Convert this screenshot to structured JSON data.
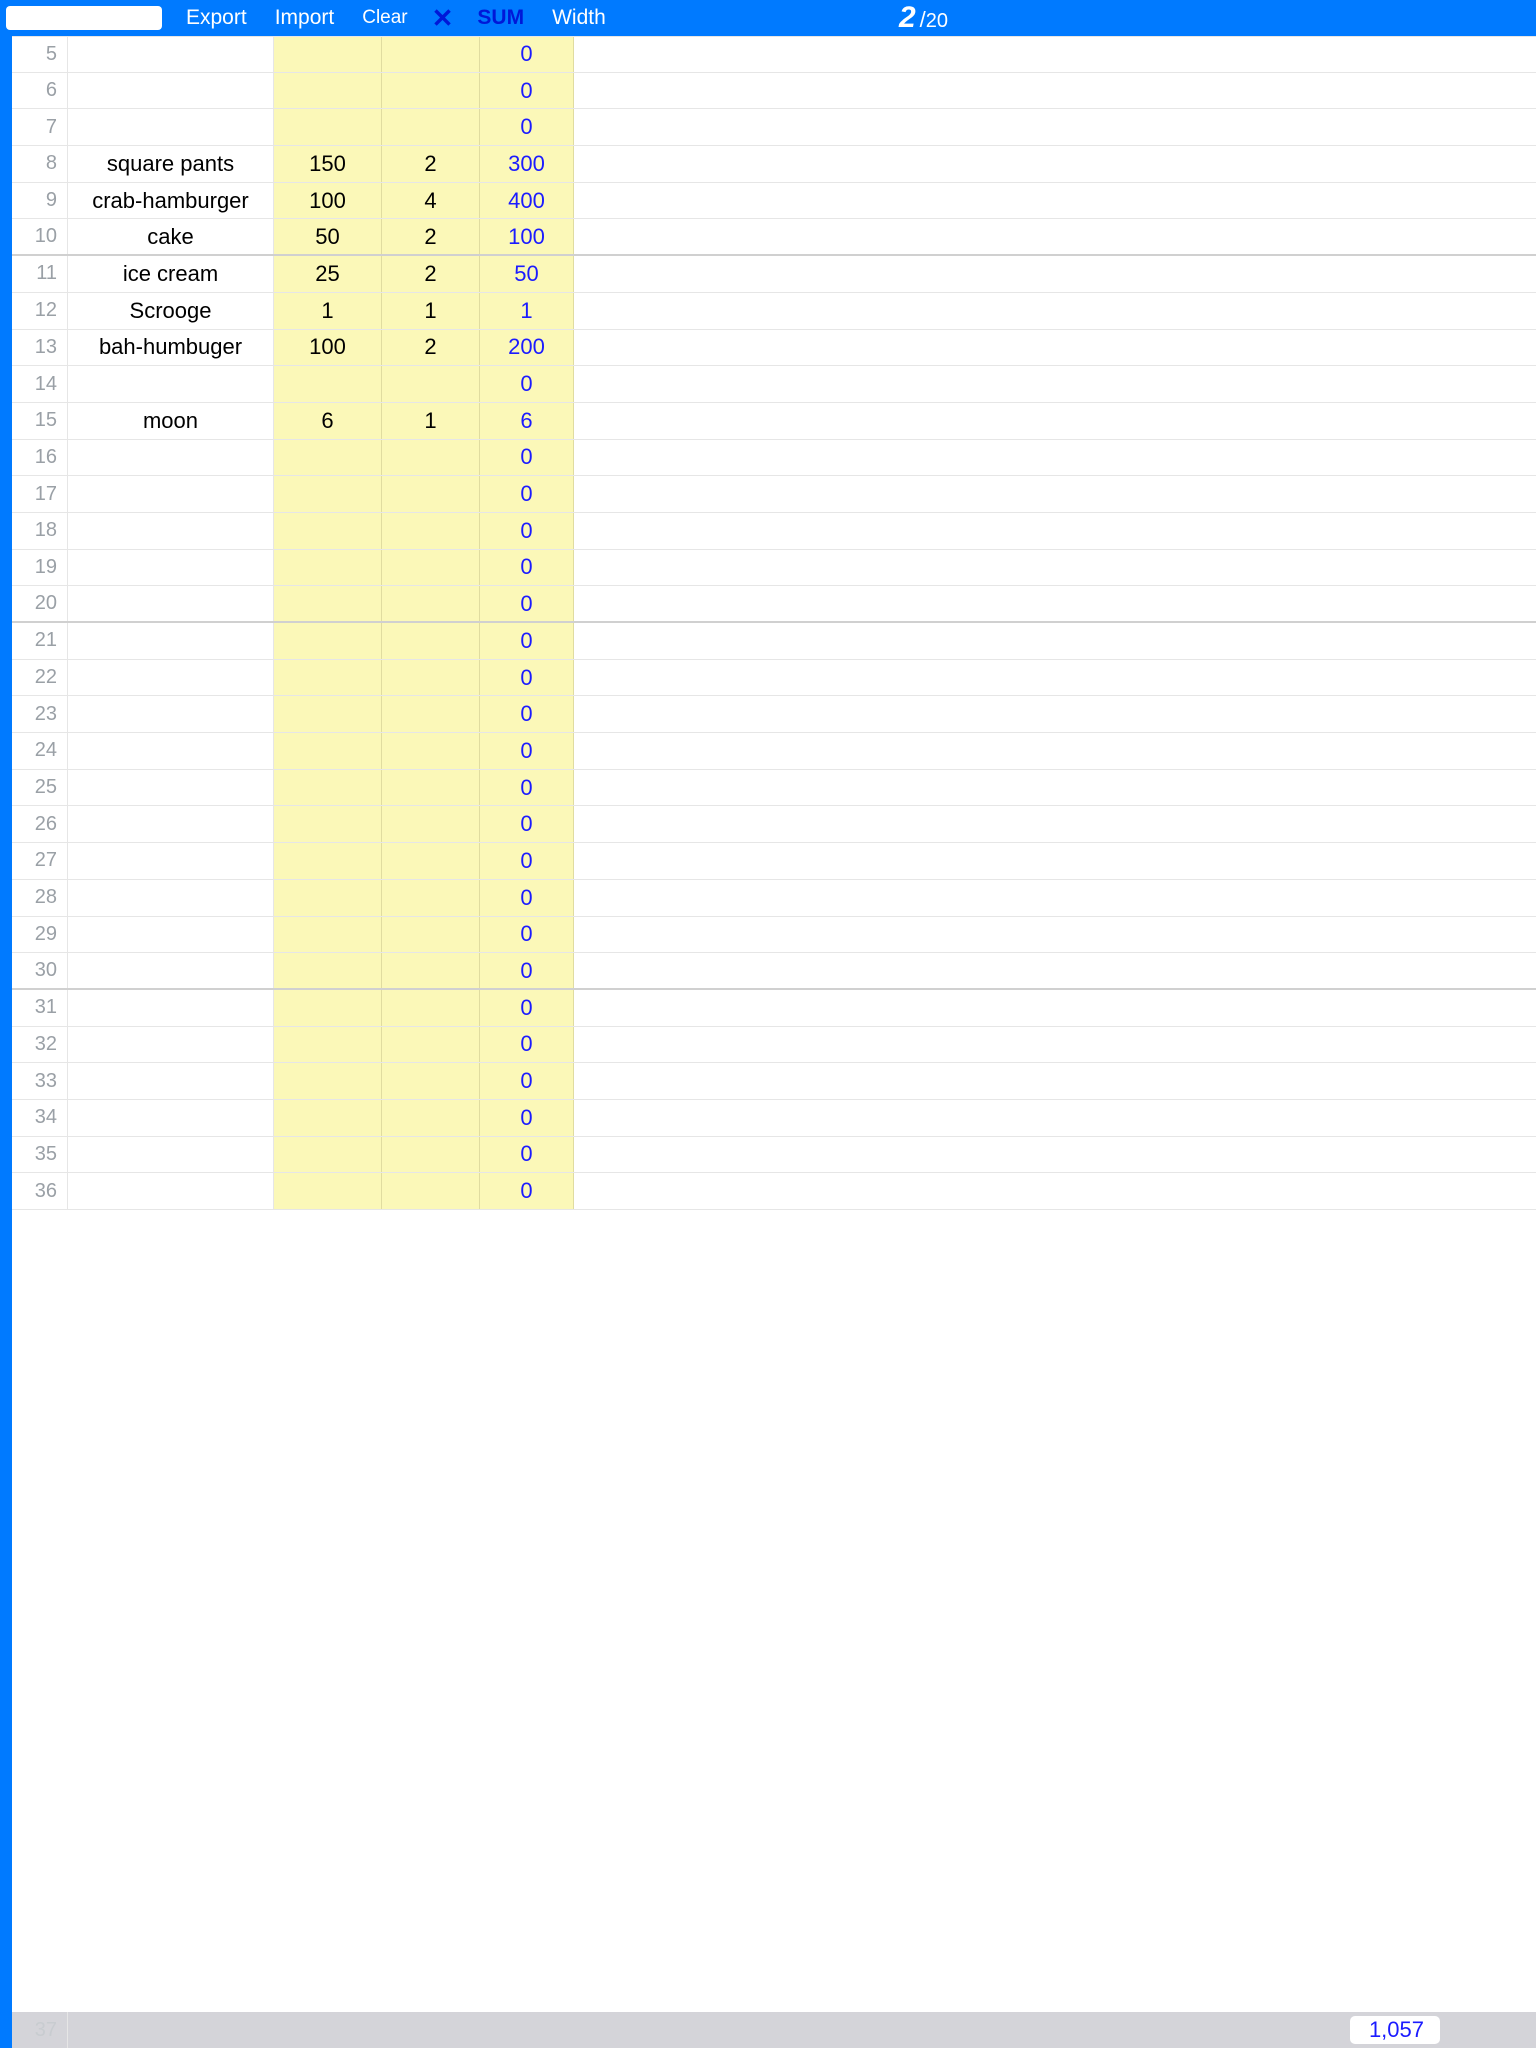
{
  "toolbar": {
    "export_label": "Export",
    "import_label": "Import",
    "clear_label": "Clear",
    "multiply_symbol": "✕",
    "sum_label": "SUM",
    "width_label": "Width",
    "counter_value": "2",
    "counter_total": "20"
  },
  "footer": {
    "row_number": "37",
    "sum_total": "1,057"
  },
  "rows": [
    {
      "n": "5",
      "name": "",
      "a": "",
      "b": "",
      "t": "0"
    },
    {
      "n": "6",
      "name": "",
      "a": "",
      "b": "",
      "t": "0"
    },
    {
      "n": "7",
      "name": "",
      "a": "",
      "b": "",
      "t": "0"
    },
    {
      "n": "8",
      "name": "square pants",
      "a": "150",
      "b": "2",
      "t": "300"
    },
    {
      "n": "9",
      "name": "crab-hamburger",
      "a": "100",
      "b": "4",
      "t": "400"
    },
    {
      "n": "10",
      "name": "cake",
      "a": "50",
      "b": "2",
      "t": "100",
      "thick": true
    },
    {
      "n": "11",
      "name": "ice cream",
      "a": "25",
      "b": "2",
      "t": "50"
    },
    {
      "n": "12",
      "name": "Scrooge",
      "a": "1",
      "b": "1",
      "t": "1"
    },
    {
      "n": "13",
      "name": "bah-humbuger",
      "a": "100",
      "b": "2",
      "t": "200"
    },
    {
      "n": "14",
      "name": "",
      "a": "",
      "b": "",
      "t": "0"
    },
    {
      "n": "15",
      "name": "moon",
      "a": "6",
      "b": "1",
      "t": "6"
    },
    {
      "n": "16",
      "name": "",
      "a": "",
      "b": "",
      "t": "0"
    },
    {
      "n": "17",
      "name": "",
      "a": "",
      "b": "",
      "t": "0"
    },
    {
      "n": "18",
      "name": "",
      "a": "",
      "b": "",
      "t": "0"
    },
    {
      "n": "19",
      "name": "",
      "a": "",
      "b": "",
      "t": "0"
    },
    {
      "n": "20",
      "name": "",
      "a": "",
      "b": "",
      "t": "0",
      "thick": true
    },
    {
      "n": "21",
      "name": "",
      "a": "",
      "b": "",
      "t": "0"
    },
    {
      "n": "22",
      "name": "",
      "a": "",
      "b": "",
      "t": "0"
    },
    {
      "n": "23",
      "name": "",
      "a": "",
      "b": "",
      "t": "0"
    },
    {
      "n": "24",
      "name": "",
      "a": "",
      "b": "",
      "t": "0"
    },
    {
      "n": "25",
      "name": "",
      "a": "",
      "b": "",
      "t": "0"
    },
    {
      "n": "26",
      "name": "",
      "a": "",
      "b": "",
      "t": "0"
    },
    {
      "n": "27",
      "name": "",
      "a": "",
      "b": "",
      "t": "0"
    },
    {
      "n": "28",
      "name": "",
      "a": "",
      "b": "",
      "t": "0"
    },
    {
      "n": "29",
      "name": "",
      "a": "",
      "b": "",
      "t": "0"
    },
    {
      "n": "30",
      "name": "",
      "a": "",
      "b": "",
      "t": "0",
      "thick": true
    },
    {
      "n": "31",
      "name": "",
      "a": "",
      "b": "",
      "t": "0"
    },
    {
      "n": "32",
      "name": "",
      "a": "",
      "b": "",
      "t": "0"
    },
    {
      "n": "33",
      "name": "",
      "a": "",
      "b": "",
      "t": "0"
    },
    {
      "n": "34",
      "name": "",
      "a": "",
      "b": "",
      "t": "0"
    },
    {
      "n": "35",
      "name": "",
      "a": "",
      "b": "",
      "t": "0"
    },
    {
      "n": "36",
      "name": "",
      "a": "",
      "b": "",
      "t": "0"
    }
  ]
}
